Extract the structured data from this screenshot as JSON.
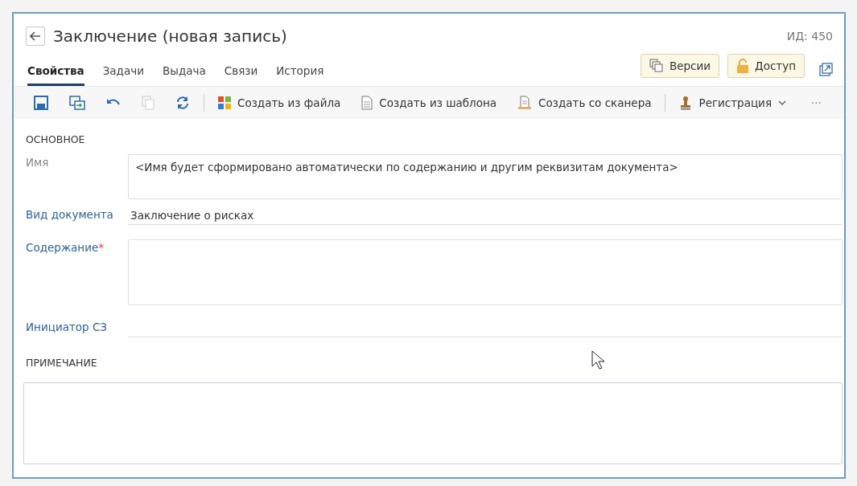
{
  "window": {
    "title": "Заключение (новая запись)",
    "id_label": "ИД: 450"
  },
  "tabs": [
    {
      "label": "Свойства",
      "selected": true
    },
    {
      "label": "Задачи",
      "selected": false
    },
    {
      "label": "Выдача",
      "selected": false
    },
    {
      "label": "Связи",
      "selected": false
    },
    {
      "label": "История",
      "selected": false
    }
  ],
  "header_buttons": [
    {
      "kind": "versions",
      "label": "Версии"
    },
    {
      "kind": "access",
      "label": "Доступ"
    },
    {
      "kind": "popout"
    }
  ],
  "toolbar": [
    {
      "kind": "save",
      "disabled": false
    },
    {
      "kind": "save-as",
      "disabled": false
    },
    {
      "kind": "undo",
      "disabled": false
    },
    {
      "kind": "copy",
      "disabled": true
    },
    {
      "kind": "refresh",
      "disabled": false
    },
    {
      "kind": "separator"
    },
    {
      "kind": "from-file",
      "label": "Создать из файла",
      "disabled": false
    },
    {
      "kind": "from-template",
      "label": "Создать из шаблона",
      "disabled": false
    },
    {
      "kind": "from-scanner",
      "label": "Создать со сканера",
      "disabled": false
    },
    {
      "kind": "separator"
    },
    {
      "kind": "registration",
      "label": "Регистрация",
      "disabled": false
    },
    {
      "kind": "more",
      "label": "···",
      "disabled": false
    }
  ],
  "sections": [
    {
      "title": "ОСНОВНОЕ",
      "fields": [
        {
          "kind": "textarea",
          "label": "Имя",
          "readonly": true,
          "value": "<Имя будет сформировано автоматически по содержанию и другим реквизитам документа>"
        },
        {
          "kind": "line",
          "label": "Вид документа",
          "readonly": false,
          "value": "Заключение о рисках"
        },
        {
          "kind": "textarea",
          "label": "Содержание",
          "readonly": false,
          "required_mark": "*"
        },
        {
          "kind": "line",
          "label": "Инициатор СЗ",
          "readonly": false
        }
      ]
    },
    {
      "title": "ПРИМЕЧАНИЕ",
      "fields": [
        {
          "kind": "note"
        }
      ]
    }
  ]
}
